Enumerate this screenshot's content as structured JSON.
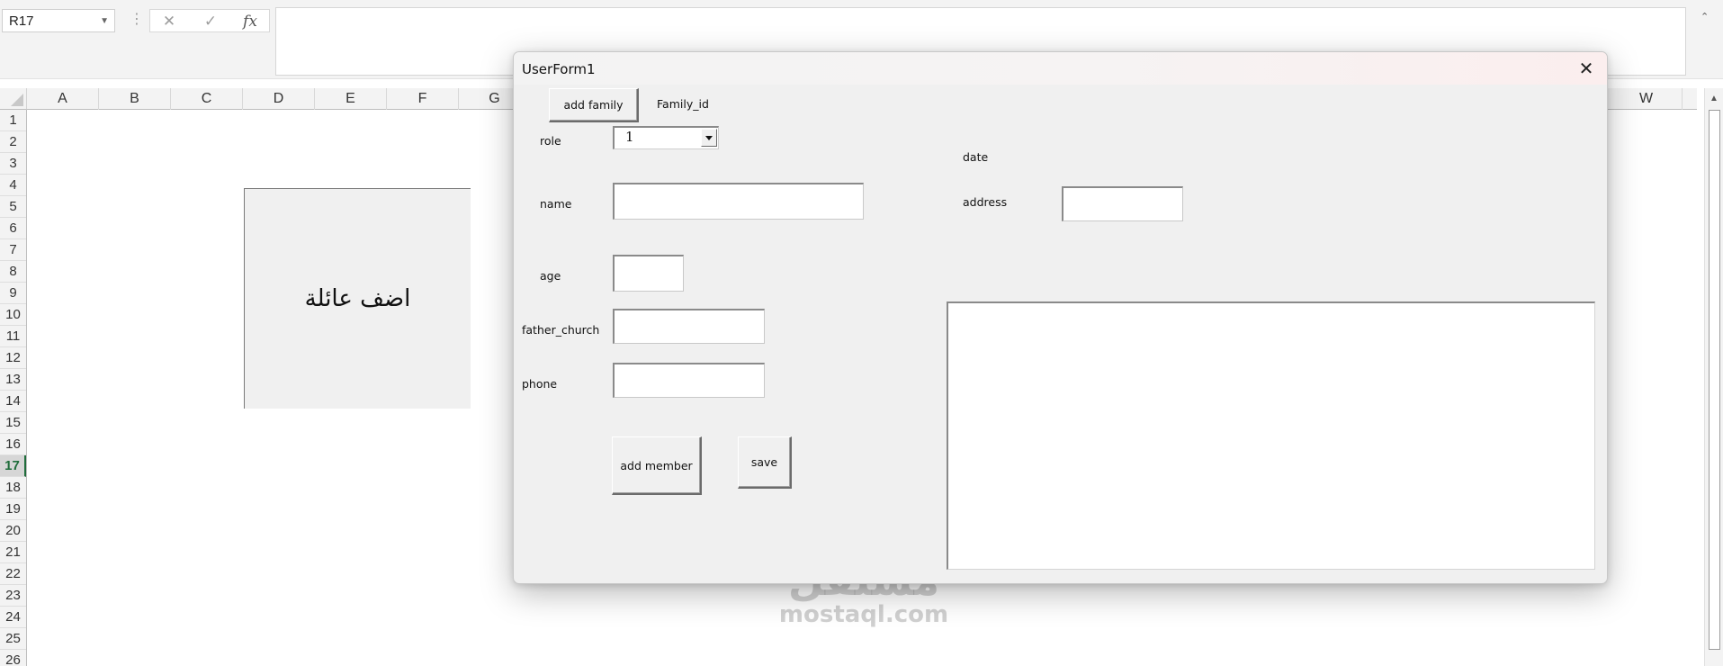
{
  "formula_bar": {
    "name_box": "R17",
    "dots": "⋮",
    "cancel_icon": "✕",
    "enter_icon": "✓",
    "fx_label": "fx",
    "formula_value": "",
    "collapse_icon": "⌃"
  },
  "sheet": {
    "columns": [
      "A",
      "B",
      "C",
      "D",
      "E",
      "F",
      "G",
      "W"
    ],
    "rows": [
      "1",
      "2",
      "3",
      "4",
      "5",
      "6",
      "7",
      "8",
      "9",
      "10",
      "11",
      "12",
      "13",
      "14",
      "15",
      "16",
      "17",
      "18",
      "19",
      "20",
      "21",
      "22",
      "23",
      "24",
      "25",
      "26"
    ],
    "active_row": "17",
    "shape_button_label": "اضف عائلة"
  },
  "userform": {
    "title": "UserForm1",
    "close_icon": "✕",
    "add_family_button": "add family",
    "family_id_label": "Family_id",
    "role_label": "role",
    "role_value": "1",
    "name_label": "name",
    "name_value": "",
    "age_label": "age",
    "age_value": "",
    "father_church_label": "father_church",
    "father_church_value": "",
    "phone_label": "phone",
    "phone_value": "",
    "date_label": "date",
    "address_label": "address",
    "address_value": "",
    "add_member_button": "add member",
    "save_button": "save",
    "listbox_items": []
  },
  "watermark": {
    "logo_text": "مستقل",
    "site": "mostaql.com"
  }
}
